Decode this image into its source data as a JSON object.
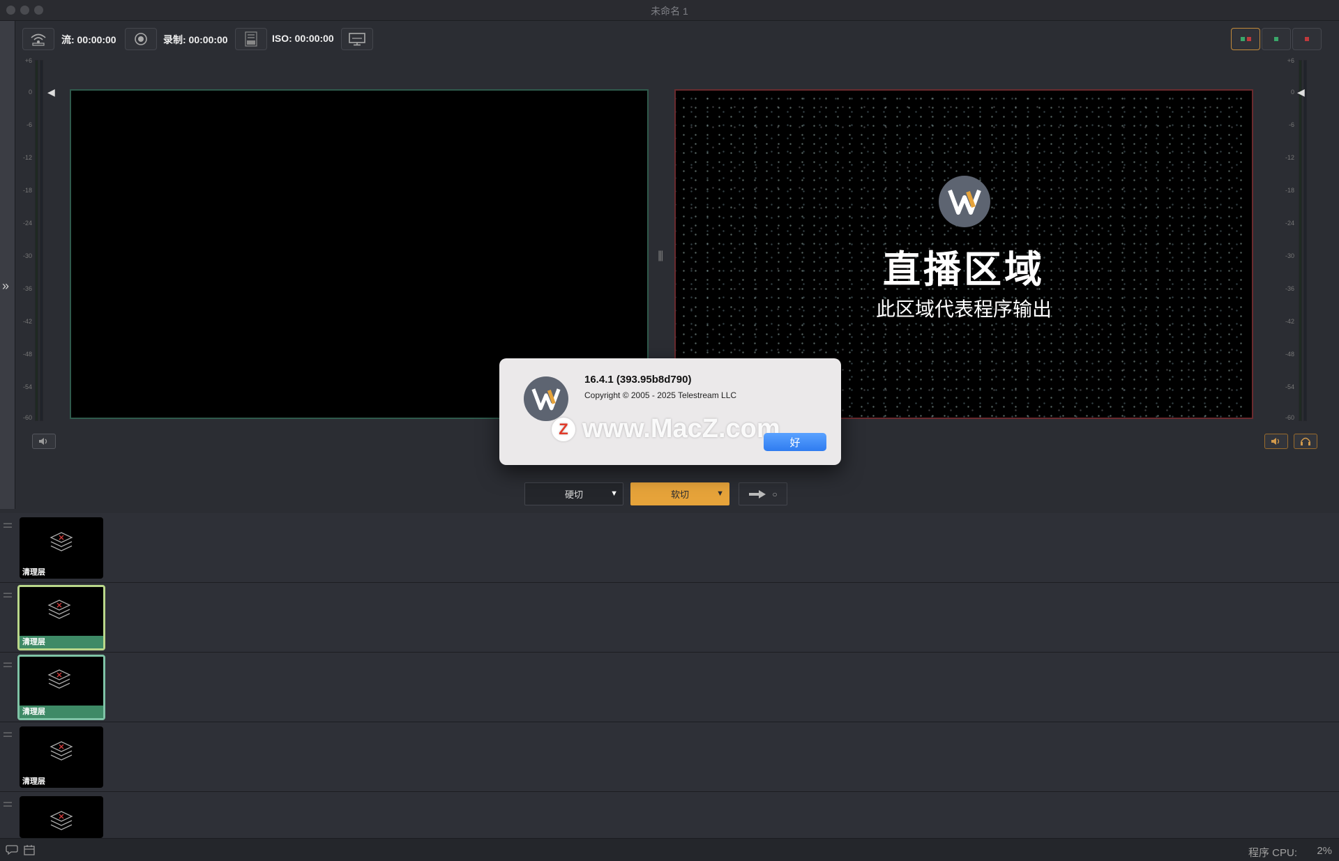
{
  "window": {
    "title": "未命名 1"
  },
  "toolbar": {
    "stream_label": "流: 00:00:00",
    "record_label": "录制: 00:00:00",
    "iso_label": "ISO: 00:00:00"
  },
  "meter_ticks": [
    "+6",
    "0",
    "-6",
    "-12",
    "-18",
    "-24",
    "-30",
    "-36",
    "-42",
    "-48",
    "-54",
    "-60"
  ],
  "program": {
    "title": "直播区域",
    "subtitle": "此区域代表程序输出"
  },
  "about": {
    "version": "16.4.1 (393.95b8d790)",
    "copyright": "Copyright © 2005 - 2025 Telestream LLC",
    "ok_label": "好",
    "watermark": "www.MacZ.com",
    "watermark_badge": "Z"
  },
  "transitions": {
    "hard_cut": "硬切",
    "soft_cut": "软切"
  },
  "layers": [
    {
      "label": "清理层",
      "state": "normal"
    },
    {
      "label": "清理层",
      "state": "selected-yellow"
    },
    {
      "label": "清理层",
      "state": "selected-green"
    },
    {
      "label": "清理层",
      "state": "normal"
    },
    {
      "label": "",
      "state": "partial"
    }
  ],
  "status": {
    "cpu_label": "程序 CPU:",
    "cpu_value": "2%"
  },
  "colors": {
    "accent_orange": "#e6a33a",
    "preview_border": "#2f5a4c",
    "program_border": "#6b2a2e",
    "ok_blue": "#2f7cf0"
  }
}
